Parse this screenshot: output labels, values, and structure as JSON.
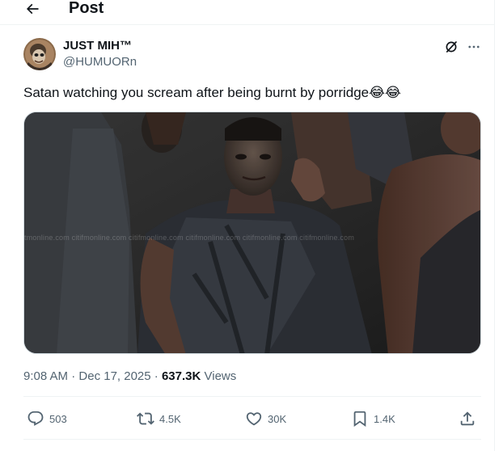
{
  "header": {
    "title": "Post",
    "back_icon": "arrow-left-icon"
  },
  "author": {
    "name": "JUST MIH™",
    "handle": "@HUMUORn"
  },
  "tweet": {
    "text": "Satan watching you scream after being burnt by porridge",
    "emojis": [
      "😂",
      "😂"
    ]
  },
  "media": {
    "watermark": "tmonline.com citifmonline.com citifmonline.com citifmonline.com citifmonline.com citifmonline.com"
  },
  "meta": {
    "time": "9:08 AM",
    "separator1": "·",
    "date": "Dec 17, 2025",
    "separator2": "·",
    "views_count": "637.3K",
    "views_label": "Views"
  },
  "actions": {
    "replies": "503",
    "reposts": "4.5K",
    "likes": "30K",
    "bookmarks": "1.4K"
  },
  "colors": {
    "text": "#0f1419",
    "secondary": "#536471",
    "border": "#eff3f4"
  }
}
